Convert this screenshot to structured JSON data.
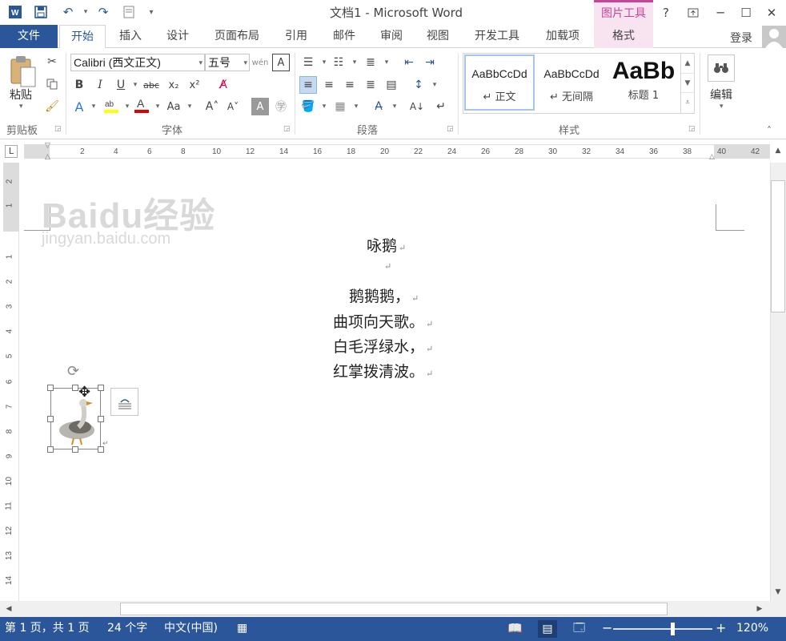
{
  "window": {
    "title": "文档1 - Microsoft Word",
    "context_tab": "图片工具"
  },
  "qat": {
    "icons": [
      "word-logo-icon",
      "save-icon",
      "undo-icon",
      "redo-icon",
      "print-preview-icon",
      "customize-icon"
    ]
  },
  "window_controls": {
    "help": "?",
    "minimize": "─",
    "maximize": "☐",
    "close": "✕"
  },
  "tabs": [
    {
      "label": "文件"
    },
    {
      "label": "开始"
    },
    {
      "label": "插入"
    },
    {
      "label": "设计"
    },
    {
      "label": "页面布局"
    },
    {
      "label": "引用"
    },
    {
      "label": "邮件"
    },
    {
      "label": "审阅"
    },
    {
      "label": "视图"
    },
    {
      "label": "开发工具"
    },
    {
      "label": "加载项"
    },
    {
      "label": "格式"
    }
  ],
  "signin": "登录",
  "ribbon": {
    "clipboard": {
      "label": "剪贴板",
      "paste": "粘贴"
    },
    "font": {
      "label": "字体",
      "font_name": "Calibri (西文正文)",
      "font_size": "五号"
    },
    "paragraph": {
      "label": "段落"
    },
    "styles": {
      "label": "样式",
      "items": [
        {
          "preview": "AaBbCcDd",
          "name": "↵ 正文"
        },
        {
          "preview": "AaBbCcDd",
          "name": "↵ 无间隔"
        },
        {
          "preview": "AaBb",
          "name": "标题 1"
        }
      ]
    },
    "editing": {
      "label": "编辑"
    }
  },
  "ruler": {
    "ticks": [
      "2",
      "4",
      "6",
      "8",
      "10",
      "12",
      "14",
      "16",
      "18",
      "20",
      "22",
      "24",
      "26",
      "28",
      "30",
      "32",
      "34",
      "36",
      "38",
      "40",
      "42"
    ],
    "vticks": [
      "2",
      "1",
      "1",
      "2",
      "3",
      "4",
      "5",
      "6",
      "7",
      "8",
      "9",
      "10",
      "11",
      "12",
      "13",
      "14"
    ]
  },
  "watermark": {
    "logo": "Baidu经验",
    "url": "jingyan.baidu.com"
  },
  "document": {
    "title": "咏鹅",
    "lines": [
      "鹅鹅鹅，",
      "曲项向天歌。",
      "白毛浮绿水，",
      "红掌拨清波。"
    ],
    "para_mark": "↵"
  },
  "status": {
    "page": "第 1 页，共 1 页",
    "words": "24 个字",
    "language": "中文(中国)",
    "zoom": "120%",
    "zoom_level": 0.6
  },
  "colors": {
    "accent": "#2b579a",
    "context_tab": "#c74597",
    "context_bg": "#f7e4f0"
  }
}
